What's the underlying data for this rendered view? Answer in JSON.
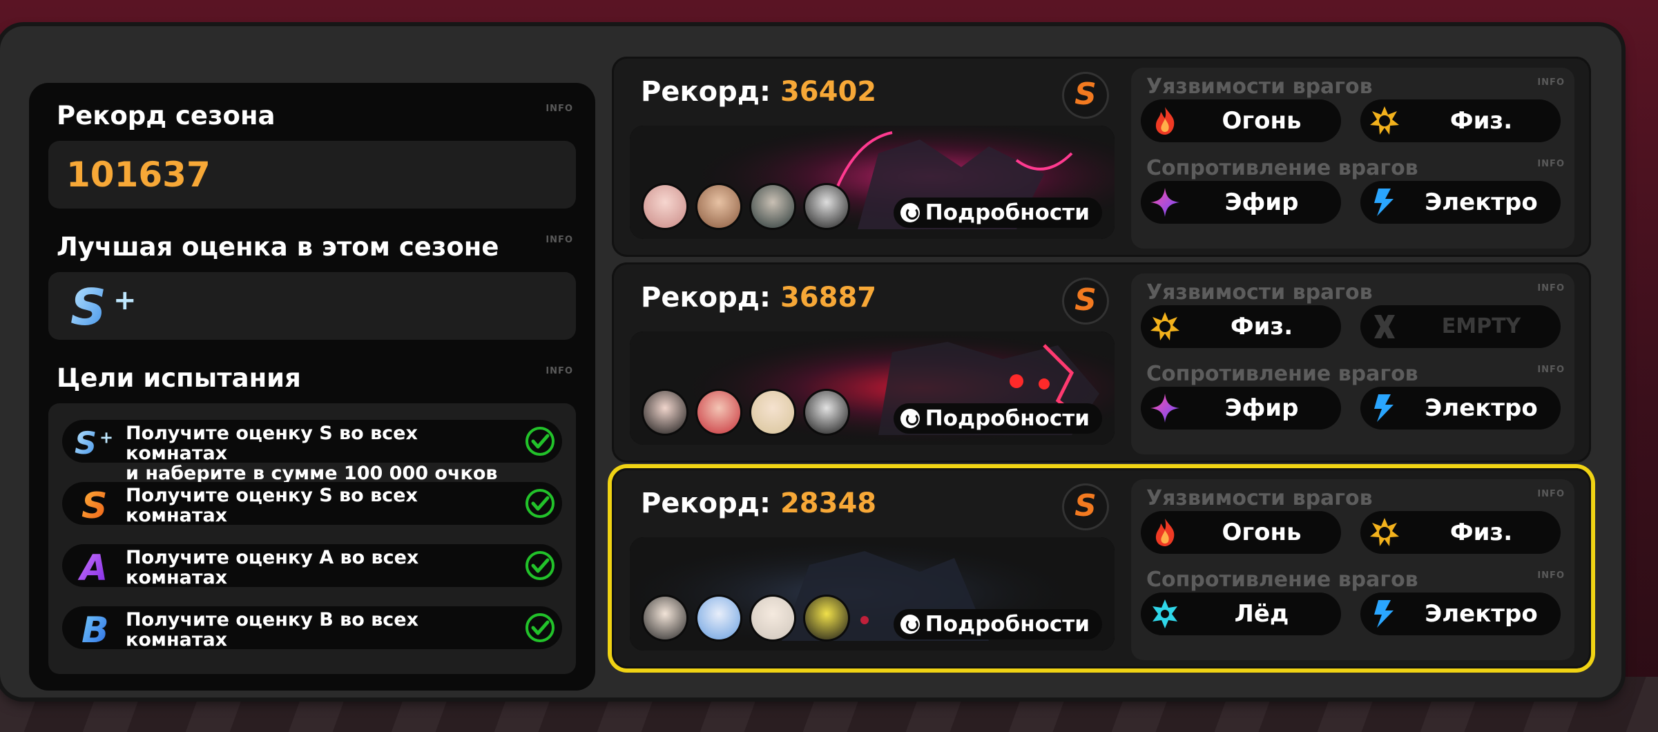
{
  "left": {
    "season_record": {
      "title": "Рекорд сезона",
      "info": "INFO",
      "value": "101637"
    },
    "best_rating": {
      "title": "Лучшая оценка в этом сезоне",
      "info": "INFO",
      "rank": "S+"
    },
    "goals": {
      "title": "Цели испытания",
      "info": "INFO",
      "items": [
        {
          "rank": "S+",
          "line1": "Получите оценку S во всех комнатах",
          "line2": "и наберите в сумме 100 000 очков",
          "done": true
        },
        {
          "rank": "S",
          "line1": "Получите оценку S во всех",
          "line2": "комнатах",
          "done": true
        },
        {
          "rank": "A",
          "line1": "Получите оценку A во всех",
          "line2": "комнатах",
          "done": true
        },
        {
          "rank": "B",
          "line1": "Получите оценку B во всех",
          "line2": "комнатах",
          "done": true
        }
      ]
    }
  },
  "records": [
    {
      "label": "Рекорд:",
      "score": "36402",
      "rank": "S",
      "details": "Подробности",
      "weak_label": "Уязвимости врагов",
      "res_label": "Сопротивление врагов",
      "info": "INFO",
      "weak": [
        {
          "name": "Огонь",
          "icon": "fire-icon"
        },
        {
          "name": "Физ.",
          "icon": "physical-icon"
        }
      ],
      "res": [
        {
          "name": "Эфир",
          "icon": "ether-icon"
        },
        {
          "name": "Электро",
          "icon": "electric-icon"
        }
      ]
    },
    {
      "label": "Рекорд:",
      "score": "36887",
      "rank": "S",
      "details": "Подробности",
      "weak_label": "Уязвимости врагов",
      "res_label": "Сопротивление врагов",
      "info": "INFO",
      "weak": [
        {
          "name": "Физ.",
          "icon": "physical-icon"
        },
        {
          "name": "EMPTY",
          "icon": "empty-x-icon"
        }
      ],
      "res": [
        {
          "name": "Эфир",
          "icon": "ether-icon"
        },
        {
          "name": "Электро",
          "icon": "electric-icon"
        }
      ]
    },
    {
      "label": "Рекорд:",
      "score": "28348",
      "rank": "S",
      "details": "Подробности",
      "weak_label": "Уязвимости врагов",
      "res_label": "Сопротивление врагов",
      "info": "INFO",
      "weak": [
        {
          "name": "Огонь",
          "icon": "fire-icon"
        },
        {
          "name": "Физ.",
          "icon": "physical-icon"
        }
      ],
      "res": [
        {
          "name": "Лёд",
          "icon": "ice-icon"
        },
        {
          "name": "Электро",
          "icon": "electric-icon"
        }
      ]
    }
  ],
  "colors": {
    "accent": "#f7a837",
    "selected": "#f0d314",
    "check": "#22c22a",
    "rank_s": "#f37a20",
    "rank_a": "#9b3cf0",
    "rank_b": "#2f8ff0"
  }
}
